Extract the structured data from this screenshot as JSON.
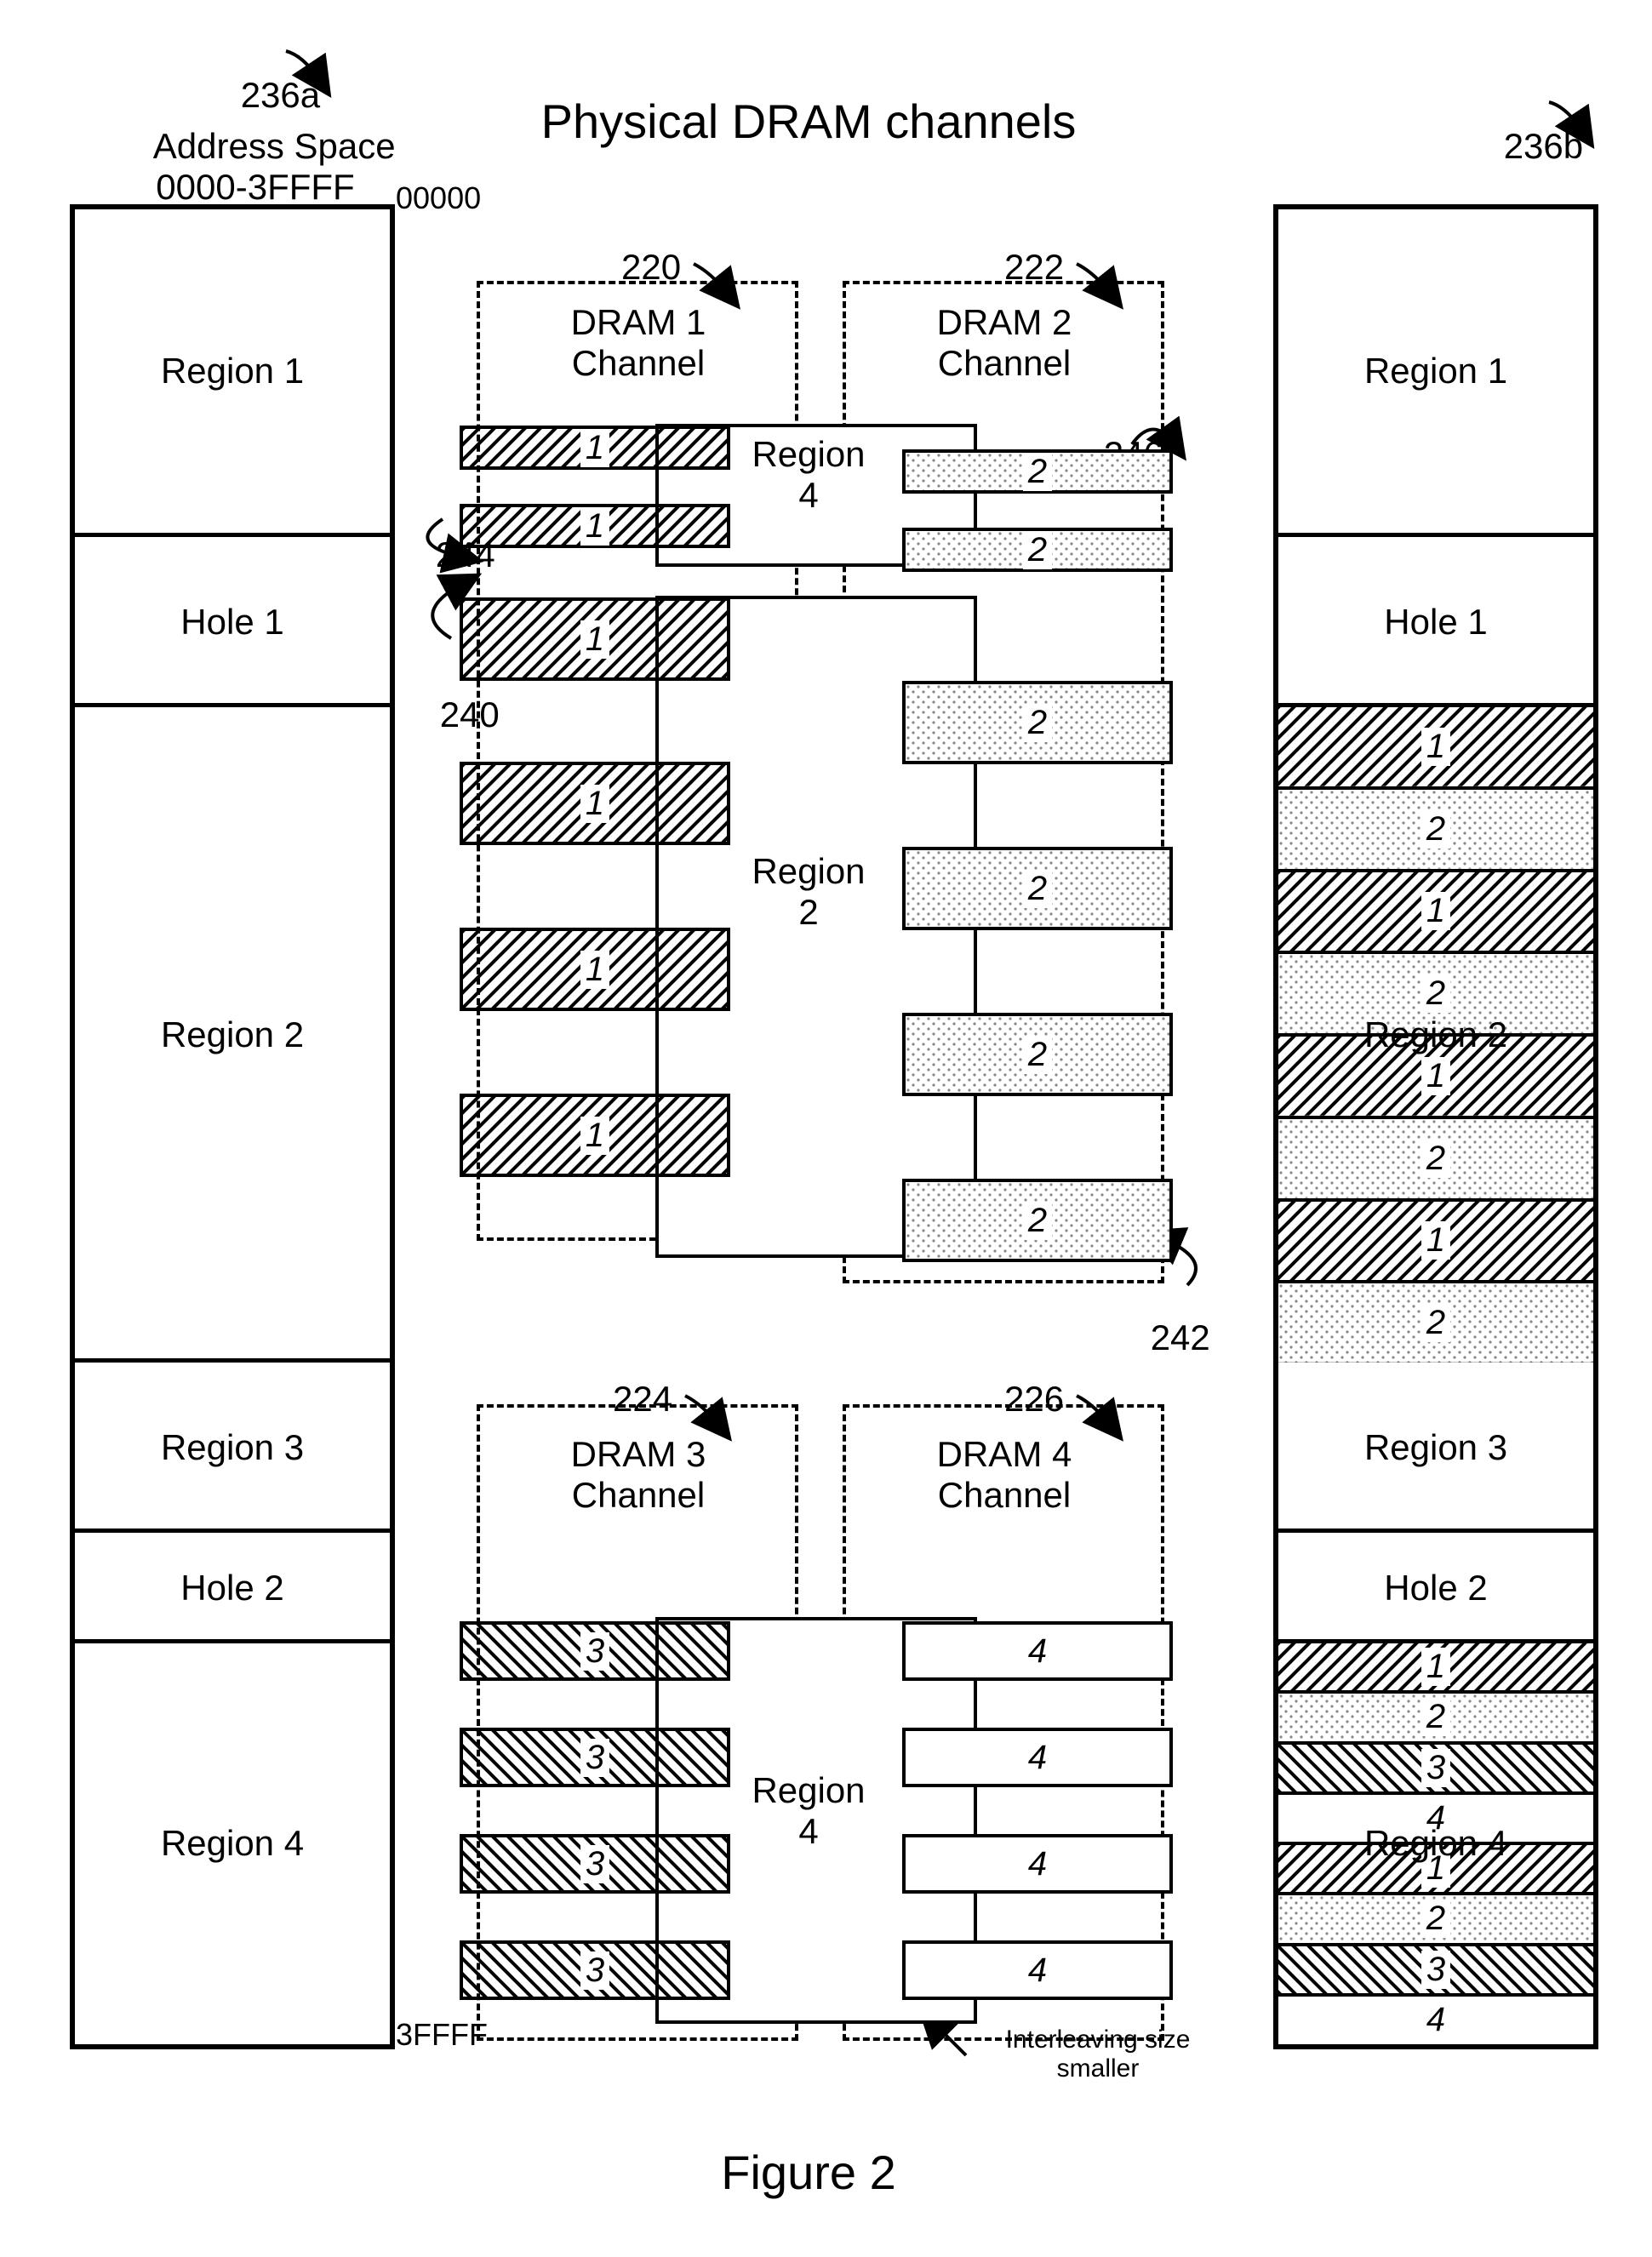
{
  "title": "Physical DRAM channels",
  "figure_caption": "Figure 2",
  "left_column": {
    "ref": "236a",
    "header_line1": "Address Space",
    "header_line2": "0000-3FFFF",
    "top_addr": "00000",
    "bottom_addr": "3FFFF",
    "rows": [
      {
        "label": "Region 1"
      },
      {
        "label": "Hole 1"
      },
      {
        "label": "Region 2"
      },
      {
        "label": "Region 3"
      },
      {
        "label": "Hole 2"
      },
      {
        "label": "Region 4"
      }
    ]
  },
  "right_column": {
    "ref": "236b",
    "rows_top": [
      {
        "label": "Region 1"
      },
      {
        "label": "Hole 1"
      }
    ],
    "region2_label": "Region 2",
    "region2_interleave": [
      "1",
      "2",
      "1",
      "2",
      "1",
      "2",
      "1",
      "2"
    ],
    "rows_mid": [
      {
        "label": "Region 3"
      },
      {
        "label": "Hole 2"
      }
    ],
    "region4_label": "Region 4",
    "region4_interleave": [
      "1",
      "2",
      "3",
      "4",
      "1",
      "2",
      "3",
      "4"
    ]
  },
  "dram_channels": {
    "d1": {
      "ref": "220",
      "title": "DRAM 1\nChannel"
    },
    "d2": {
      "ref": "222",
      "title": "DRAM 2\nChannel"
    },
    "d3": {
      "ref": "224",
      "title": "DRAM 3\nChannel"
    },
    "d4": {
      "ref": "226",
      "title": "DRAM 4\nChannel"
    }
  },
  "region_labels": {
    "region2": "Region\n2",
    "region4_top": "Region\n4",
    "region4_bottom": "Region\n4"
  },
  "bar_labels": {
    "one": "1",
    "two": "2",
    "three": "3",
    "four": "4"
  },
  "notes": {
    "interleave_small": "Interleaving size\nsmaller"
  },
  "callouts": {
    "c240": "240",
    "c242": "242",
    "c244": "244",
    "c246": "246"
  }
}
